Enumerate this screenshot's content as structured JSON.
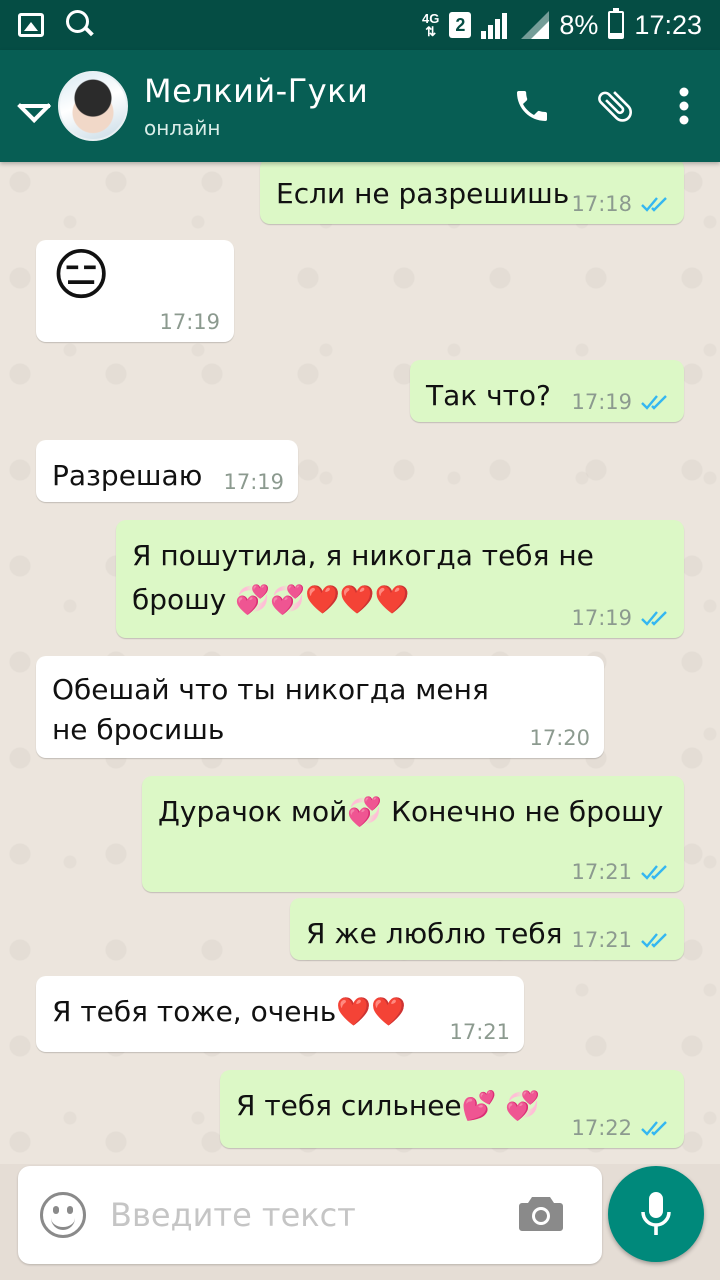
{
  "status_bar": {
    "network": "4G",
    "sim": "2",
    "battery": "8%",
    "time": "17:23"
  },
  "header": {
    "contact_name": "Мелкий-Гуки",
    "contact_status": "онлайн"
  },
  "colors": {
    "status_bar": "#054d44",
    "toolbar": "#075e54",
    "incoming_bubble": "#ffffff",
    "outgoing_bubble": "#dcf8c6",
    "read_ticks": "#34b7f1",
    "mic_button": "#00897b"
  },
  "messages": [
    {
      "direction": "out",
      "text": "Если не разрешишь",
      "time": "17:18",
      "status": "read"
    },
    {
      "direction": "in",
      "text": "😑",
      "time": "17:19"
    },
    {
      "direction": "out",
      "text": "Так что?",
      "time": "17:19",
      "status": "read"
    },
    {
      "direction": "in",
      "text": "Разрешаю",
      "time": "17:19"
    },
    {
      "direction": "out",
      "text": "Я пошутила, я никогда тебя не брошу 💞💞❤️❤️❤️",
      "time": "17:19",
      "status": "read"
    },
    {
      "direction": "in",
      "text": "Обешай что ты никогда меня не бросишь",
      "time": "17:20"
    },
    {
      "direction": "out",
      "text": "Дурачок мой💞  Конечно не брошу",
      "time": "17:21",
      "status": "read"
    },
    {
      "direction": "out",
      "text": "Я же люблю тебя",
      "time": "17:21",
      "status": "read"
    },
    {
      "direction": "in",
      "text": "Я тебя тоже, очень❤️❤️",
      "time": "17:21"
    },
    {
      "direction": "out",
      "text": "Я тебя сильнее💕 💞",
      "time": "17:22",
      "status": "read"
    }
  ],
  "composer": {
    "placeholder": "Введите текст"
  },
  "icons": {
    "back": "arrow-left-icon",
    "call": "phone-icon",
    "attach": "paperclip-icon",
    "menu": "more-vert-icon",
    "emoji": "smiley-icon",
    "camera": "camera-icon",
    "mic": "microphone-icon"
  }
}
